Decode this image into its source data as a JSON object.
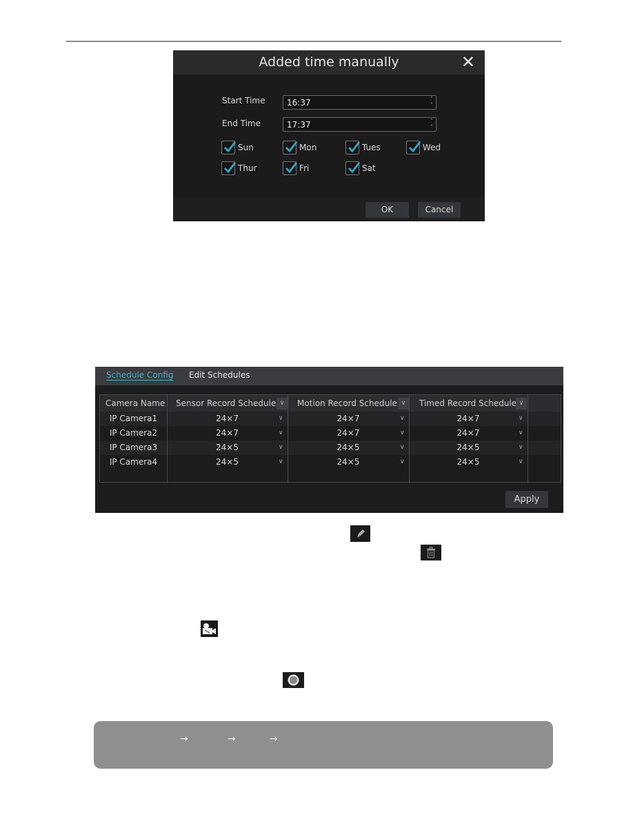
{
  "dialog": {
    "title": "Added time manually",
    "close_icon": "close-x-icon",
    "start_time_label": "Start Time",
    "start_time_value": "16:37",
    "end_time_label": "End Time",
    "end_time_value": "17:37",
    "days": [
      {
        "label": "Sun",
        "checked": true
      },
      {
        "label": "Mon",
        "checked": true
      },
      {
        "label": "Tues",
        "checked": true
      },
      {
        "label": "Wed",
        "checked": true
      },
      {
        "label": "Thur",
        "checked": true
      },
      {
        "label": "Fri",
        "checked": true
      },
      {
        "label": "Sat",
        "checked": true
      }
    ],
    "ok_label": "OK",
    "cancel_label": "Cancel",
    "check_color": "#2fa3c4"
  },
  "schedule": {
    "tabs": [
      {
        "label": "Schedule Config",
        "active": true
      },
      {
        "label": "Edit Schedules",
        "active": false
      }
    ],
    "columns": [
      "Camera Name",
      "Sensor Record Schedule",
      "Motion Record Schedule",
      "Timed Record Schedule"
    ],
    "rows": [
      [
        "IP Camera1",
        "24×7",
        "24×7",
        "24×7"
      ],
      [
        "IP Camera2",
        "24×7",
        "24×7",
        "24×7"
      ],
      [
        "IP Camera3",
        "24×5",
        "24×5",
        "24×5"
      ],
      [
        "IP Camera4",
        "24×5",
        "24×5",
        "24×5"
      ]
    ],
    "apply_label": "Apply",
    "accent_color": "#3ab0d6"
  },
  "icons": [
    "edit-pencil-icon",
    "trash-icon",
    "record-camera-icon",
    "record-circle-icon"
  ],
  "note": {
    "arrows": [
      "→",
      "→",
      "→"
    ],
    "background": "#8f8f8f"
  }
}
